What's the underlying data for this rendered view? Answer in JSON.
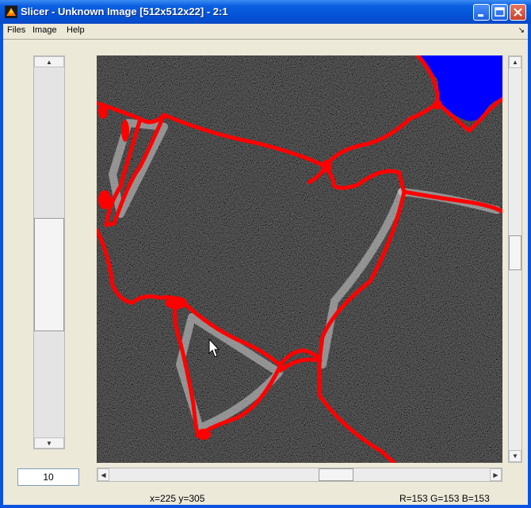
{
  "window": {
    "title": "Slicer - Unknown Image [512x512x22] - 2:1",
    "controls": [
      "minimize",
      "maximize",
      "close"
    ]
  },
  "menubar": {
    "items": [
      "Files",
      "Image",
      "Help"
    ],
    "dock_icon": "↘"
  },
  "slice": {
    "value": "10"
  },
  "status": {
    "coords": "x=225 y=305",
    "rgb": "R=153 G=153 B=153"
  },
  "image": {
    "segment_color": "#ff0000",
    "selected_region_color": "#0000ff",
    "background_color": "#000000"
  },
  "colors": {
    "titlebar": "#0a5fe0",
    "client": "#ece9d8"
  }
}
